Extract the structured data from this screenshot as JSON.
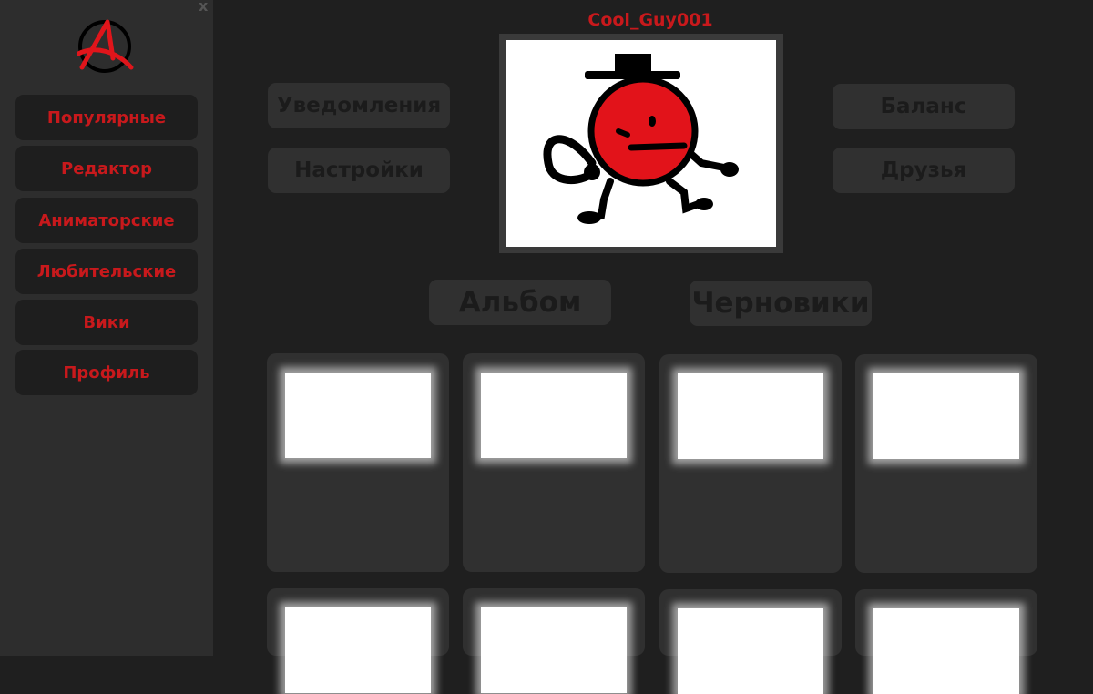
{
  "window": {
    "close_label": "x"
  },
  "sidebar": {
    "items": [
      {
        "label": "Популярные"
      },
      {
        "label": "Редактор"
      },
      {
        "label": "Аниматорские"
      },
      {
        "label": "Любительские"
      },
      {
        "label": "Вики"
      },
      {
        "label": "Профиль"
      }
    ]
  },
  "profile": {
    "username": "Cool_Guy001",
    "buttons": {
      "notifications": "Уведомления",
      "settings": "Настройки",
      "balance": "Баланс",
      "friends": "Друзья"
    }
  },
  "tabs": {
    "album": "Альбом",
    "drafts": "Черновики"
  },
  "colors": {
    "accent": "#c8191c",
    "background": "#1f1f1f",
    "sidebar": "#2d2d2d",
    "panel": "#303030"
  }
}
